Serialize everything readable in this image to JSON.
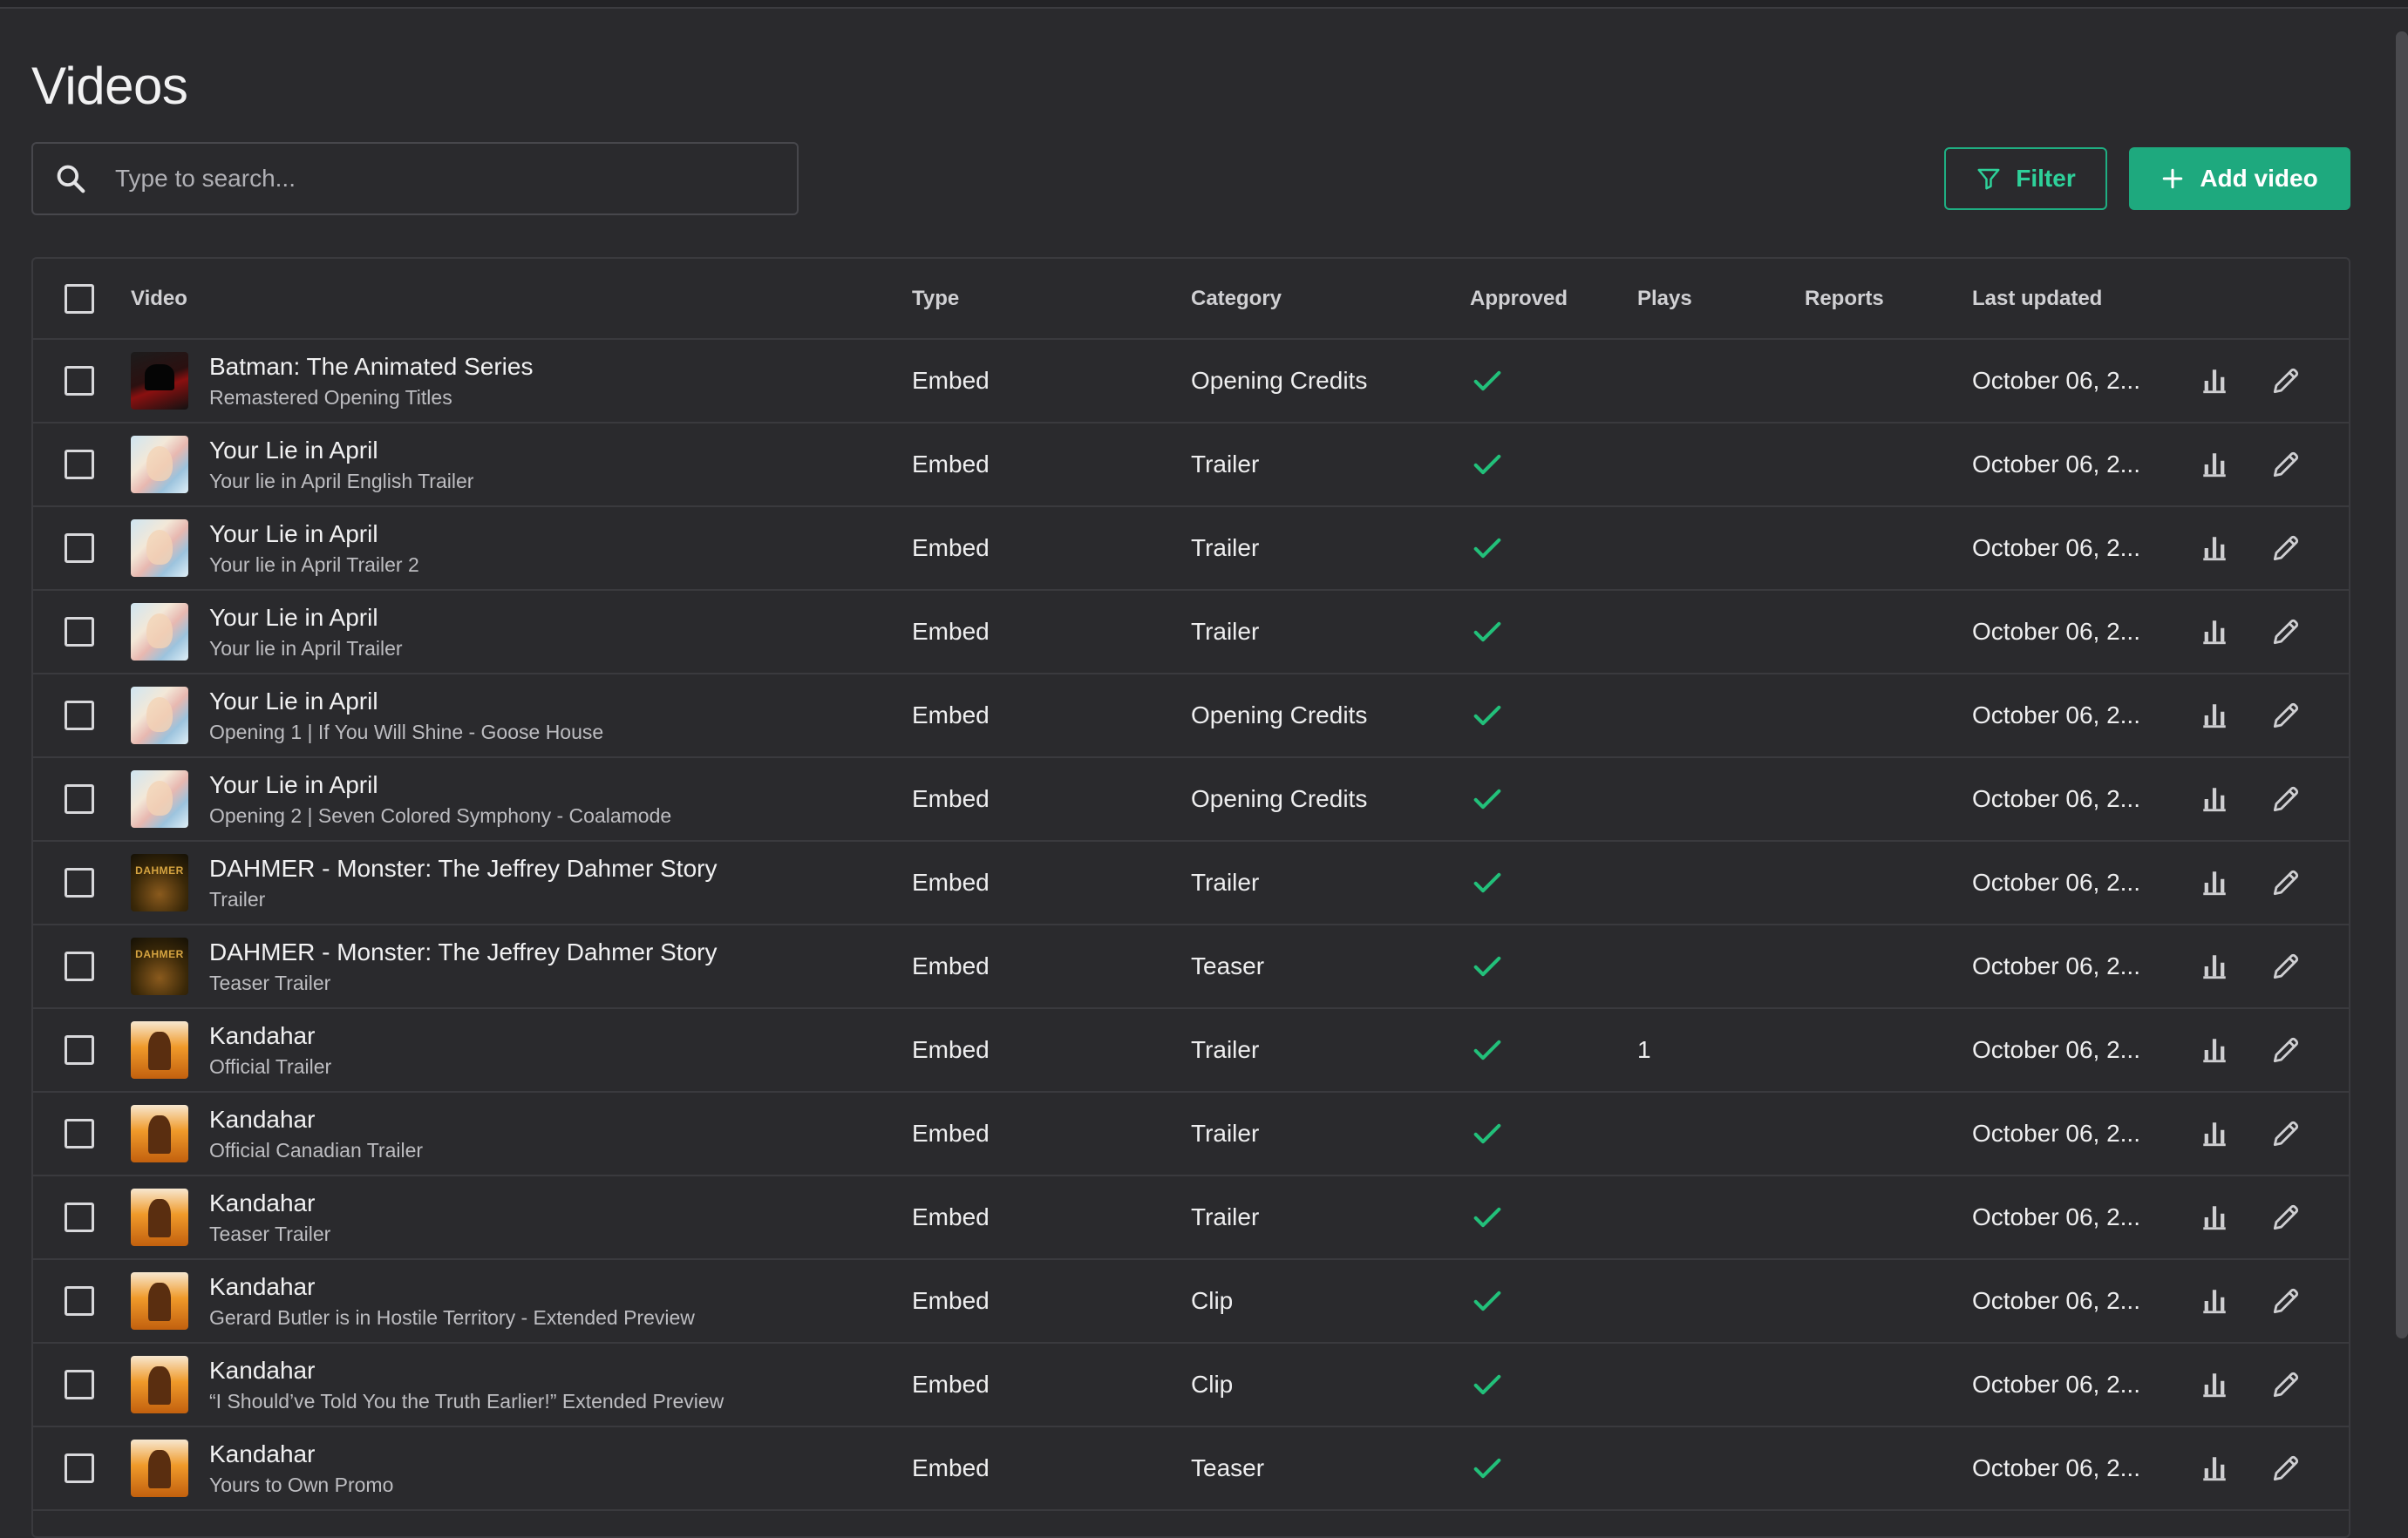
{
  "page": {
    "title": "Videos"
  },
  "search": {
    "placeholder": "Type to search..."
  },
  "toolbar": {
    "filter_label": "Filter",
    "add_label": "Add video"
  },
  "colors": {
    "accent": "#1ea97e",
    "check": "#22c07a",
    "background": "#2a2a2d"
  },
  "table": {
    "headers": {
      "video": "Video",
      "type": "Type",
      "category": "Category",
      "approved": "Approved",
      "plays": "Plays",
      "reports": "Reports",
      "last_updated": "Last updated"
    },
    "rows": [
      {
        "thumb": "batman",
        "title": "Batman: The Animated Series",
        "subtitle": "Remastered Opening Titles",
        "type": "Embed",
        "category": "Opening Credits",
        "approved": true,
        "plays": "",
        "reports": "",
        "last_updated": "October 06, 2..."
      },
      {
        "thumb": "lie",
        "title": "Your Lie in April",
        "subtitle": "Your lie in April English Trailer",
        "type": "Embed",
        "category": "Trailer",
        "approved": true,
        "plays": "",
        "reports": "",
        "last_updated": "October 06, 2..."
      },
      {
        "thumb": "lie",
        "title": "Your Lie in April",
        "subtitle": "Your lie in April Trailer 2",
        "type": "Embed",
        "category": "Trailer",
        "approved": true,
        "plays": "",
        "reports": "",
        "last_updated": "October 06, 2..."
      },
      {
        "thumb": "lie",
        "title": "Your Lie in April",
        "subtitle": "Your lie in April Trailer",
        "type": "Embed",
        "category": "Trailer",
        "approved": true,
        "plays": "",
        "reports": "",
        "last_updated": "October 06, 2..."
      },
      {
        "thumb": "lie",
        "title": "Your Lie in April",
        "subtitle": "Opening 1 | If You Will Shine - Goose House",
        "type": "Embed",
        "category": "Opening Credits",
        "approved": true,
        "plays": "",
        "reports": "",
        "last_updated": "October 06, 2..."
      },
      {
        "thumb": "lie",
        "title": "Your Lie in April",
        "subtitle": "Opening 2 | Seven Colored Symphony - Coalamode",
        "type": "Embed",
        "category": "Opening Credits",
        "approved": true,
        "plays": "",
        "reports": "",
        "last_updated": "October 06, 2..."
      },
      {
        "thumb": "dahmer",
        "title": "DAHMER - Monster: The Jeffrey Dahmer Story",
        "subtitle": "Trailer",
        "type": "Embed",
        "category": "Trailer",
        "approved": true,
        "plays": "",
        "reports": "",
        "last_updated": "October 06, 2..."
      },
      {
        "thumb": "dahmer",
        "title": "DAHMER - Monster: The Jeffrey Dahmer Story",
        "subtitle": "Teaser Trailer",
        "type": "Embed",
        "category": "Teaser",
        "approved": true,
        "plays": "",
        "reports": "",
        "last_updated": "October 06, 2..."
      },
      {
        "thumb": "kandahar",
        "title": "Kandahar",
        "subtitle": "Official Trailer",
        "type": "Embed",
        "category": "Trailer",
        "approved": true,
        "plays": "1",
        "reports": "",
        "last_updated": "October 06, 2..."
      },
      {
        "thumb": "kandahar",
        "title": "Kandahar",
        "subtitle": "Official Canadian Trailer",
        "type": "Embed",
        "category": "Trailer",
        "approved": true,
        "plays": "",
        "reports": "",
        "last_updated": "October 06, 2..."
      },
      {
        "thumb": "kandahar",
        "title": "Kandahar",
        "subtitle": "Teaser Trailer",
        "type": "Embed",
        "category": "Trailer",
        "approved": true,
        "plays": "",
        "reports": "",
        "last_updated": "October 06, 2..."
      },
      {
        "thumb": "kandahar",
        "title": "Kandahar",
        "subtitle": "Gerard Butler is in Hostile Territory - Extended Preview",
        "type": "Embed",
        "category": "Clip",
        "approved": true,
        "plays": "",
        "reports": "",
        "last_updated": "October 06, 2..."
      },
      {
        "thumb": "kandahar",
        "title": "Kandahar",
        "subtitle": "“I Should’ve Told You the Truth Earlier!” Extended Preview",
        "type": "Embed",
        "category": "Clip",
        "approved": true,
        "plays": "",
        "reports": "",
        "last_updated": "October 06, 2..."
      },
      {
        "thumb": "kandahar",
        "title": "Kandahar",
        "subtitle": "Yours to Own Promo",
        "type": "Embed",
        "category": "Teaser",
        "approved": true,
        "plays": "",
        "reports": "",
        "last_updated": "October 06, 2..."
      }
    ]
  }
}
